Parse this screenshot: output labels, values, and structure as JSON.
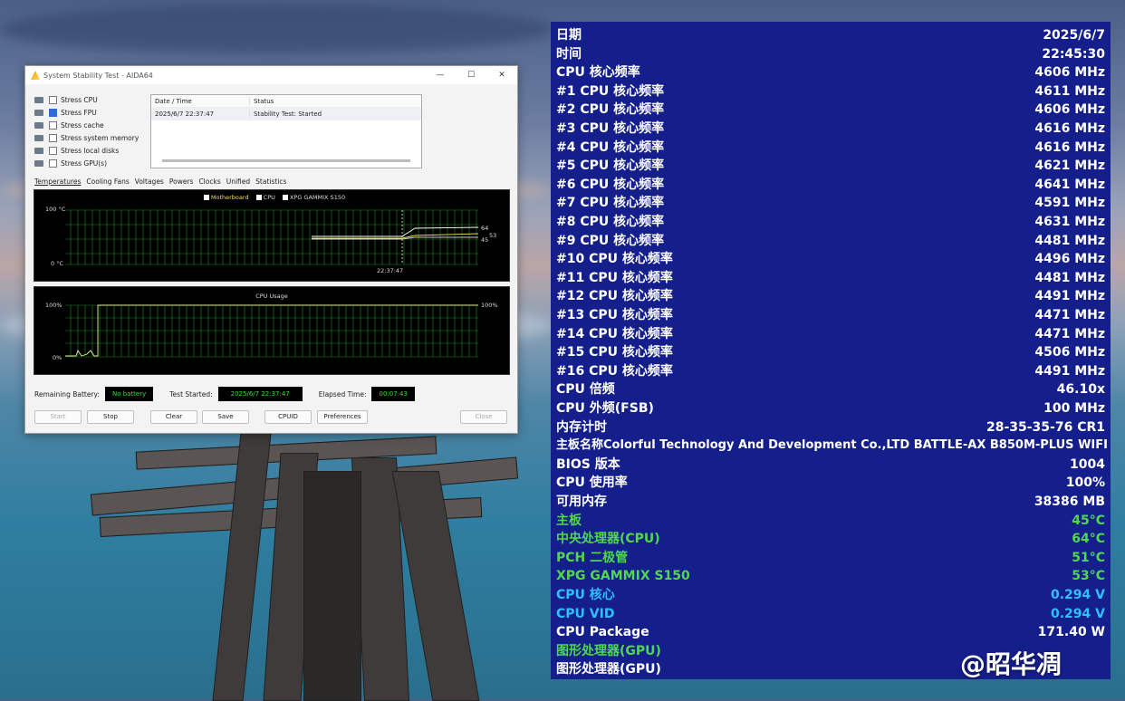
{
  "window": {
    "title": "System Stability Test - AIDA64",
    "controls": [
      "—",
      "☐",
      "✕"
    ],
    "stress_options": [
      {
        "label": "Stress CPU",
        "checked": false
      },
      {
        "label": "Stress FPU",
        "checked": true
      },
      {
        "label": "Stress cache",
        "checked": false
      },
      {
        "label": "Stress system memory",
        "checked": false
      },
      {
        "label": "Stress local disks",
        "checked": false
      },
      {
        "label": "Stress GPU(s)",
        "checked": false
      }
    ],
    "log": {
      "headers": [
        "Date / Time",
        "Status"
      ],
      "rows": [
        {
          "time": "2025/6/7 22:37:47",
          "status": "Stability Test: Started"
        }
      ]
    },
    "tabs": [
      "Temperatures",
      "Cooling Fans",
      "Voltages",
      "Powers",
      "Clocks",
      "Unified",
      "Statistics"
    ],
    "temp_graph": {
      "legend": [
        "Motherboard",
        "CPU",
        "XPG GAMMIX S150"
      ],
      "y_top": "100 °C",
      "y_bottom": "0 °C",
      "x_label": "22:37:47",
      "readouts": [
        "64",
        "53",
        "45"
      ]
    },
    "cpu_graph": {
      "title": "CPU Usage",
      "y_top": "100%",
      "y_bottom": "0%",
      "right_readout": "100%"
    },
    "status": {
      "battery_label": "Remaining Battery:",
      "battery_value": "No battery",
      "started_label": "Test Started:",
      "started_value": "2025/6/7 22:37:47",
      "elapsed_label": "Elapsed Time:",
      "elapsed_value": "00:07:43"
    },
    "buttons": [
      "Start",
      "Stop",
      "Clear",
      "Save",
      "CPUID",
      "Preferences",
      "Close"
    ]
  },
  "osd": {
    "rows": [
      {
        "label": "日期",
        "value": "2025/6/7",
        "color": "#ffffff"
      },
      {
        "label": "时间",
        "value": "22:45:30",
        "color": "#ffffff"
      },
      {
        "label": "CPU 核心频率",
        "value": "4606 MHz",
        "color": "#ffffff"
      },
      {
        "label": "#1 CPU 核心频率",
        "value": "4611 MHz",
        "color": "#ffffff"
      },
      {
        "label": "#2 CPU 核心频率",
        "value": "4606 MHz",
        "color": "#ffffff"
      },
      {
        "label": "#3 CPU 核心频率",
        "value": "4616 MHz",
        "color": "#ffffff"
      },
      {
        "label": "#4 CPU 核心频率",
        "value": "4616 MHz",
        "color": "#ffffff"
      },
      {
        "label": "#5 CPU 核心频率",
        "value": "4621 MHz",
        "color": "#ffffff"
      },
      {
        "label": "#6 CPU 核心频率",
        "value": "4641 MHz",
        "color": "#ffffff"
      },
      {
        "label": "#7 CPU 核心频率",
        "value": "4591 MHz",
        "color": "#ffffff"
      },
      {
        "label": "#8 CPU 核心频率",
        "value": "4631 MHz",
        "color": "#ffffff"
      },
      {
        "label": "#9 CPU 核心频率",
        "value": "4481 MHz",
        "color": "#ffffff"
      },
      {
        "label": "#10 CPU 核心频率",
        "value": "4496 MHz",
        "color": "#ffffff"
      },
      {
        "label": "#11 CPU 核心频率",
        "value": "4481 MHz",
        "color": "#ffffff"
      },
      {
        "label": "#12 CPU 核心频率",
        "value": "4491 MHz",
        "color": "#ffffff"
      },
      {
        "label": "#13 CPU 核心频率",
        "value": "4471 MHz",
        "color": "#ffffff"
      },
      {
        "label": "#14 CPU 核心频率",
        "value": "4471 MHz",
        "color": "#ffffff"
      },
      {
        "label": "#15 CPU 核心频率",
        "value": "4506 MHz",
        "color": "#ffffff"
      },
      {
        "label": "#16 CPU 核心频率",
        "value": "4491 MHz",
        "color": "#ffffff"
      },
      {
        "label": "CPU 倍频",
        "value": "46.10x",
        "color": "#ffffff"
      },
      {
        "label": "CPU 外频(FSB)",
        "value": "100 MHz",
        "color": "#ffffff"
      },
      {
        "label": "内存计时",
        "value": "28-35-35-76 CR1",
        "color": "#ffffff"
      },
      {
        "label": "主板名称",
        "value": "Colorful Technology And Development Co.,LTD BATTLE-AX B850M-PLUS WIFI",
        "color": "#ffffff"
      },
      {
        "label": "BIOS 版本",
        "value": "1004",
        "color": "#ffffff"
      },
      {
        "label": "CPU 使用率",
        "value": "100%",
        "color": "#ffffff"
      },
      {
        "label": "可用内存",
        "value": "38386 MB",
        "color": "#ffffff"
      },
      {
        "label": "主板",
        "value": "45°C",
        "color": "#4fd84f"
      },
      {
        "label": "中央处理器(CPU)",
        "value": "64°C",
        "color": "#4fd84f"
      },
      {
        "label": "PCH 二极管",
        "value": "51°C",
        "color": "#4fd84f"
      },
      {
        "label": "XPG GAMMIX S150",
        "value": "53°C",
        "color": "#4fd84f"
      },
      {
        "label": "CPU 核心",
        "value": "0.294 V",
        "color": "#2fc0ff"
      },
      {
        "label": "CPU VID",
        "value": "0.294 V",
        "color": "#2fc0ff"
      },
      {
        "label": "CPU Package",
        "value": "171.40 W",
        "color": "#ffffff"
      },
      {
        "label": "图形处理器(GPU)",
        "value": "",
        "color": "#4fd84f"
      },
      {
        "label": "图形处理器(GPU)",
        "value": "",
        "color": "#ffffff"
      }
    ]
  },
  "watermark": "@昭华凋"
}
